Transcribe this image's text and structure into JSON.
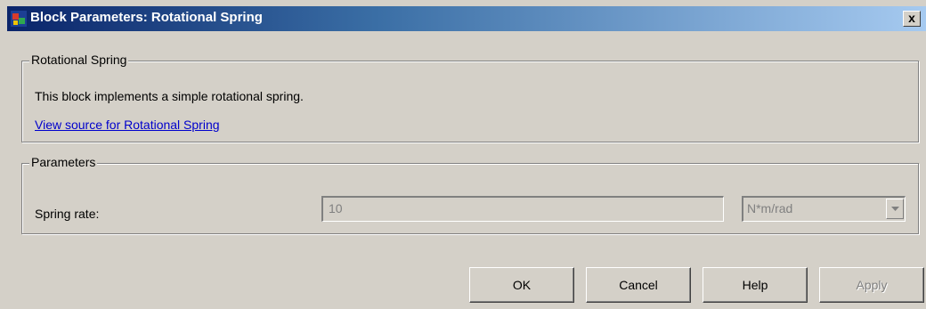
{
  "window": {
    "title": "Block Parameters: Rotational Spring",
    "close_label": "x"
  },
  "description_group": {
    "legend": "Rotational Spring",
    "description": "This block implements a simple rotational spring.",
    "source_link": "View source for Rotational Spring"
  },
  "parameters_group": {
    "legend": "Parameters",
    "spring_rate_label": "Spring rate:",
    "spring_rate_value": "10",
    "spring_rate_unit": "N*m/rad"
  },
  "buttons": {
    "ok": "OK",
    "cancel": "Cancel",
    "help": "Help",
    "apply": "Apply"
  },
  "colors": {
    "title_gradient_start": "#0a246a",
    "title_gradient_end": "#a6caf0",
    "window_background": "#d4d0c8",
    "link": "#0000cc",
    "disabled_text": "#808080"
  },
  "icons": {
    "app": "simulink-block-icon",
    "close": "close-icon",
    "dropdown": "chevron-down-icon"
  }
}
